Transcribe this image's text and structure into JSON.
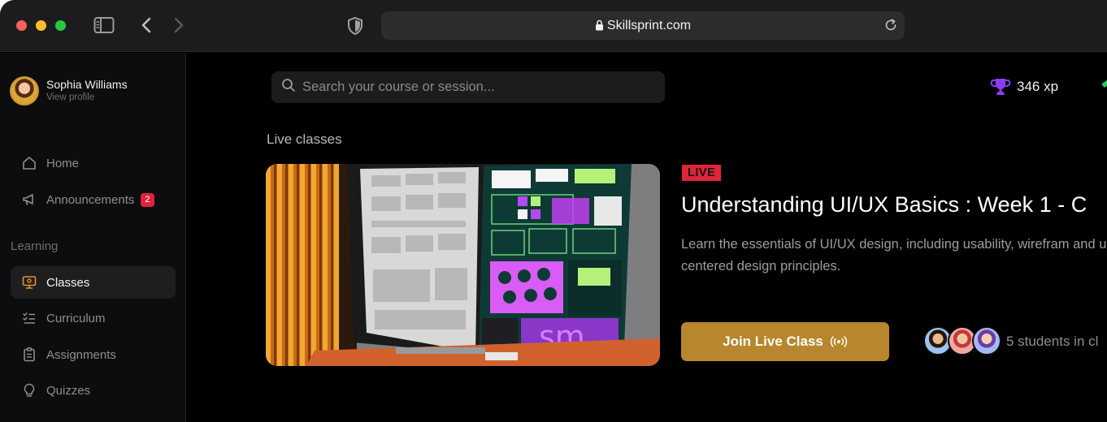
{
  "browser": {
    "url": "Skillsprint.com"
  },
  "profile": {
    "name": "Sophia Williams",
    "link": "View profile"
  },
  "sidebar": {
    "items": [
      {
        "label": "Home",
        "icon": "home-icon"
      },
      {
        "label": "Announcements",
        "icon": "megaphone-icon",
        "badge": "2"
      },
      {
        "label": "Classes",
        "icon": "monitor-icon",
        "active": true
      },
      {
        "label": "Curriculum",
        "icon": "checklist-icon"
      },
      {
        "label": "Assignments",
        "icon": "clipboard-icon"
      },
      {
        "label": "Quizzes",
        "icon": "lightbulb-icon"
      }
    ],
    "section_learning": "Learning"
  },
  "search": {
    "placeholder": "Search your course or session..."
  },
  "stats": {
    "xp": "346 xp"
  },
  "main": {
    "section_title": "Live classes",
    "live_class": {
      "badge": "LIVE",
      "title": "Understanding UI/UX Basics :  Week 1 - C",
      "description": "Learn the essentials of UI/UX design, including usability, wirefram and user-centered design principles.",
      "join_label": "Join Live Class",
      "students_text": "5 students in cl"
    }
  },
  "colors": {
    "accent_gold": "#b8862c",
    "live_red": "#e0243a",
    "xp_purple": "#8b3cf7"
  }
}
